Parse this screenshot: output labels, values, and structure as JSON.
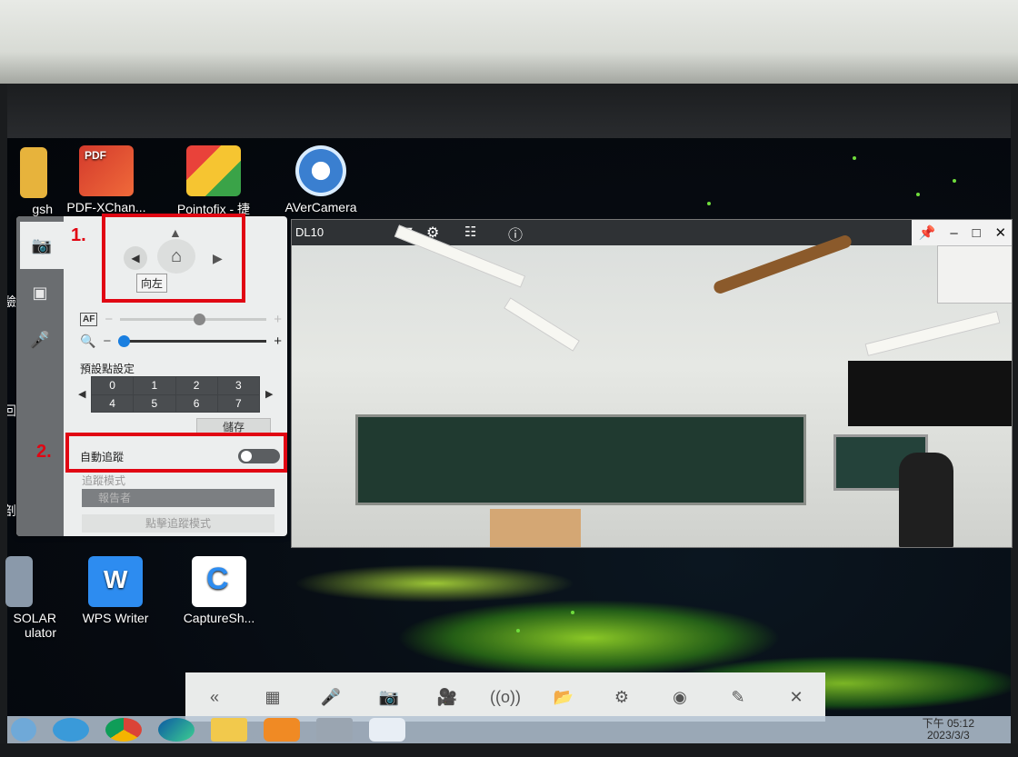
{
  "desktop": {
    "icons_top": [
      {
        "label": "gsh",
        "icon": "partial-app-icon",
        "color": "#e7b33c"
      },
      {
        "label": "PDF-XChan...",
        "icon": "pdf-xchange-icon",
        "color": "#d7483c"
      },
      {
        "label": "Pointofix - 捷",
        "icon": "pointofix-icon",
        "color": "#f0b42a"
      },
      {
        "label": "AVerCamera",
        "icon": "avercamera-icon",
        "color": "#3a7fd0"
      }
    ],
    "icons_bottom": [
      {
        "label": "SOLAR\nulator",
        "icon": "calculator-icon",
        "color": "#8a99aa"
      },
      {
        "label": "WPS Writer",
        "icon": "wps-writer-icon",
        "color": "#2d8cf0"
      },
      {
        "label": "CaptureSh...",
        "icon": "captureshare-icon",
        "color": "#ffffff"
      }
    ],
    "left_edge_text": [
      "驗",
      "回",
      "剖"
    ]
  },
  "control_panel": {
    "tabs": [
      "camera-settings-icon",
      "screen-icon",
      "voice-tracking-icon"
    ],
    "tooltip": "向左",
    "preset_title": "預設點設定",
    "presets": [
      "0",
      "1",
      "2",
      "3",
      "4",
      "5",
      "6",
      "7"
    ],
    "save_label": "儲存",
    "auto_track_label": "自動追蹤",
    "track_mode_label": "追蹤模式",
    "track_mode_value": "報告者",
    "click_track_label": "點擊追蹤模式",
    "af_label": "AF",
    "focus_level": 0.5,
    "zoom_level": 0.05
  },
  "annotations": {
    "step1": "1.",
    "step2": "2."
  },
  "camera_window": {
    "device": "DL10",
    "controls": [
      "settings-gear-icon",
      "adjust-icon",
      "info-icon"
    ],
    "window_buttons": [
      "pin-icon",
      "minimize-icon",
      "maximize-icon",
      "close-icon"
    ]
  },
  "bottom_toolbar": {
    "items": [
      "collapse-icon",
      "layout-icon",
      "voice-tracking-icon",
      "snapshot-icon",
      "record-icon",
      "broadcast-icon",
      "folder-icon",
      "settings-icon",
      "remote-icon",
      "pen-icon",
      "close-icon"
    ]
  },
  "taskbar": {
    "apps": [
      "ie-icon",
      "chrome-icon",
      "edge-icon",
      "explorer-icon",
      "media-icon",
      "calculator-icon",
      "captureshare-icon"
    ],
    "time": "下午 05:12",
    "date": "2023/3/3"
  }
}
